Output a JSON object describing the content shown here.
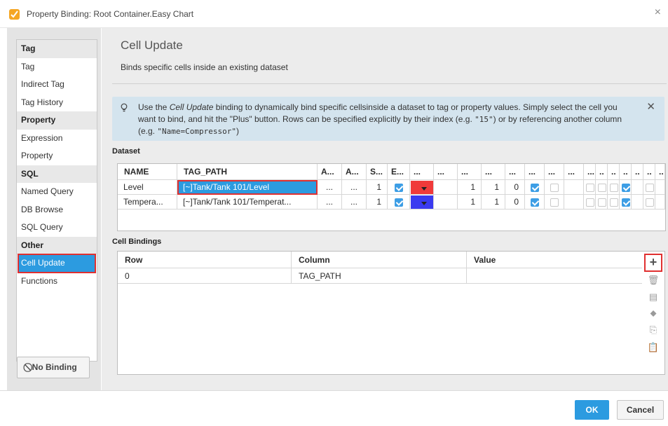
{
  "window": {
    "title": "Property Binding: Root Container.Easy Chart",
    "close_glyph": "×"
  },
  "sidebar": {
    "items": [
      {
        "label": "Tag",
        "kind": "header"
      },
      {
        "label": "Tag",
        "kind": "item"
      },
      {
        "label": "Indirect Tag",
        "kind": "item"
      },
      {
        "label": "Tag History",
        "kind": "item"
      },
      {
        "label": "Property",
        "kind": "header"
      },
      {
        "label": "Expression",
        "kind": "item"
      },
      {
        "label": "Property",
        "kind": "item"
      },
      {
        "label": "SQL",
        "kind": "header"
      },
      {
        "label": "Named Query",
        "kind": "item"
      },
      {
        "label": "DB Browse",
        "kind": "item"
      },
      {
        "label": "SQL Query",
        "kind": "item"
      },
      {
        "label": "Other",
        "kind": "header"
      },
      {
        "label": "Cell Update",
        "kind": "selected"
      },
      {
        "label": "Functions",
        "kind": "item"
      }
    ],
    "no_binding_label": "No Binding"
  },
  "main": {
    "title": "Cell Update",
    "subtitle": "Binds specific cells inside an existing dataset",
    "info": {
      "part1": "Use the ",
      "italic": "Cell Update",
      "part2": " binding to dynamically bind specific cellsinside a dataset to tag or property values. Simply select the cell you want to bind, and hit the \"Plus\" button. Rows can be specified explicitly by their index (e.g. ",
      "code1": "\"15\"",
      "part3": ") or by referencing another column (e.g. ",
      "code2": "\"Name=Compressor\"",
      "part4": ")"
    },
    "dataset_label": "Dataset",
    "dataset": {
      "headers": [
        "NAME",
        "TAG_PATH",
        "A...",
        "A...",
        "S...",
        "E...",
        "...",
        "...",
        "...",
        "...",
        "...",
        "...",
        "...",
        "...",
        "...",
        "..",
        "..",
        "..",
        "..",
        "..",
        ".."
      ],
      "rows": [
        {
          "name": "Level",
          "tag_path": "[~]Tank/Tank 101/Level",
          "a1": "...",
          "a2": "...",
          "s": "1",
          "e": true,
          "color": "#f03a3a",
          "n1": "1",
          "n2": "1",
          "n3": "0",
          "c1": true,
          "c2": false,
          "c3": false,
          "c4": false,
          "c5": false,
          "c6": true,
          "c7": false
        },
        {
          "name": "Tempera...",
          "tag_path": "[~]Tank/Tank 101/Temperat...",
          "a1": "...",
          "a2": "...",
          "s": "1",
          "e": true,
          "color": "#3a3af0",
          "n1": "1",
          "n2": "1",
          "n3": "0",
          "c1": true,
          "c2": false,
          "c3": false,
          "c4": false,
          "c5": false,
          "c6": true,
          "c7": false
        }
      ]
    },
    "cell_bindings_label": "Cell Bindings",
    "cell_bindings": {
      "headers": [
        "Row",
        "Column",
        "Value"
      ],
      "rows": [
        {
          "row": "0",
          "column": "TAG_PATH",
          "value": ""
        }
      ]
    },
    "tools": [
      {
        "name": "add-binding-button",
        "glyph": "+"
      },
      {
        "name": "delete-binding-button",
        "glyph": "🗑"
      },
      {
        "name": "edit-binding-button",
        "glyph": "▤"
      },
      {
        "name": "tag-icon-button",
        "glyph": "⬥"
      },
      {
        "name": "copy-binding-button",
        "glyph": "⎘"
      },
      {
        "name": "paste-binding-button",
        "glyph": "📋"
      }
    ]
  },
  "footer": {
    "ok_label": "OK",
    "cancel_label": "Cancel"
  },
  "colors": {
    "accent": "#2c9be0",
    "highlight_border": "#e03030",
    "info_bg": "#d4e4ee"
  }
}
